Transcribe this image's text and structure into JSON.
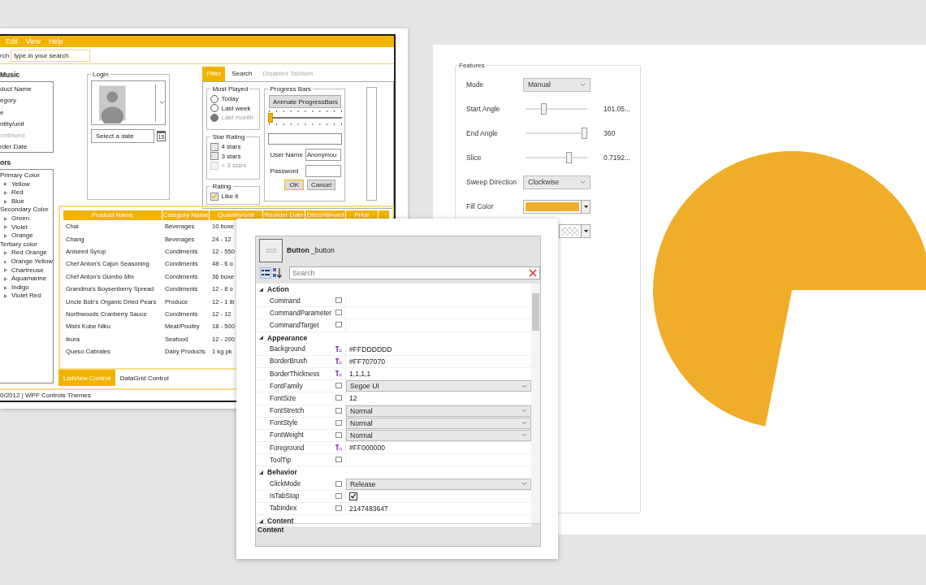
{
  "left_window": {
    "menu": [
      "Edit",
      "View",
      "Help"
    ],
    "search": {
      "label": "rch",
      "placeholder": "type in your search"
    },
    "list_header": "Music",
    "list_items": [
      {
        "label": "duct Name",
        "disabled": false
      },
      {
        "label": "egory",
        "disabled": false
      },
      {
        "label": "e",
        "disabled": false
      },
      {
        "label": "ntity/unit",
        "disabled": false
      },
      {
        "label": "ontinued",
        "disabled": true
      },
      {
        "label": "rder Date",
        "disabled": false
      }
    ],
    "tree_header": "ors",
    "tree": [
      {
        "label": "Primary Color",
        "children": [
          {
            "label": "Yellow",
            "expanded": false
          },
          {
            "label": "Red",
            "expanded": false
          },
          {
            "label": "Blue",
            "expanded": false
          }
        ]
      },
      {
        "label": "Secondary Color",
        "children": [
          {
            "label": "Green",
            "expanded": false
          },
          {
            "label": "Violet",
            "expanded": false
          },
          {
            "label": "Orange",
            "expanded": false
          }
        ]
      },
      {
        "label": "Tertiary color",
        "children": [
          {
            "label": "Red Orange",
            "expanded": false
          },
          {
            "label": "Orange Yellow",
            "expanded": false
          },
          {
            "label": "Chartreuse",
            "expanded": false
          },
          {
            "label": "Aquamarine",
            "expanded": false
          },
          {
            "label": "Indigo",
            "expanded": false
          },
          {
            "label": "Violet Red",
            "expanded": false
          }
        ]
      }
    ],
    "login": {
      "title": "Login",
      "date_placeholder": "Select a date",
      "calendar_day": "15"
    },
    "tabs": [
      {
        "label": "Filter",
        "selected": true,
        "disabled": false
      },
      {
        "label": "Search",
        "selected": false,
        "disabled": false
      },
      {
        "label": "Disabled TabItem",
        "selected": false,
        "disabled": true
      }
    ],
    "most_played": {
      "title": "Most Played",
      "options": [
        {
          "label": "Today",
          "selected": false,
          "disabled": false
        },
        {
          "label": "Last week",
          "selected": false,
          "disabled": false
        },
        {
          "label": "Last month",
          "selected": true,
          "disabled": true
        }
      ]
    },
    "star_rating": {
      "title": "Star Rating",
      "options": [
        {
          "label": "4 stars",
          "checked": false,
          "disabled": false
        },
        {
          "label": "3 stars",
          "checked": false,
          "disabled": false
        },
        {
          "label": "< 3 stars",
          "checked": false,
          "disabled": true
        }
      ]
    },
    "rating": {
      "title": "Rating",
      "options": [
        {
          "label": "Like it",
          "checked": true,
          "disabled": false
        }
      ]
    },
    "progress": {
      "title": "Progress Bars",
      "button": "Animate ProgressBars",
      "slider": {
        "level": 0
      },
      "bar": {
        "level": 0
      },
      "vertical_bar": {
        "level": 0
      },
      "fields": [
        {
          "label": "User Name",
          "value": "Anonymou"
        },
        {
          "label": "Password"
        }
      ],
      "buttons": [
        {
          "label": "OK",
          "default": true
        },
        {
          "label": "Cancel",
          "default": false
        }
      ]
    },
    "listview": {
      "columns": [
        "Product Name",
        "Category Name",
        "Quantity/unit",
        "Reorder Date",
        "Discontinued",
        "Price"
      ],
      "rows": [
        [
          "Chai",
          "Beverages",
          "10 boxe"
        ],
        [
          "Chang",
          "Beverages",
          "24 - 12"
        ],
        [
          "Aniseed Syrup",
          "Condiments",
          "12 - 550"
        ],
        [
          "Chef Anton's Cajun Seasoning",
          "Condiments",
          "48 - 6 o"
        ],
        [
          "Chef Anton's Gumbo Mix",
          "Condiments",
          "36 boxe"
        ],
        [
          "Grandma's Boysenberry Spread",
          "Condiments",
          "12 - 8 o"
        ],
        [
          "Uncle Bob's Organic Dried Pears",
          "Produce",
          "12 - 1 lb"
        ],
        [
          "Northwoods Cranberry Sauce",
          "Condiments",
          "12 - 12"
        ],
        [
          "Mishi Kobe Niku",
          "Meat/Poultry",
          "18 - 500"
        ],
        [
          "Ikura",
          "Seafood",
          "12 - 200"
        ],
        [
          "Queso Cabrales",
          "Dairy Products",
          "1 kg pk"
        ]
      ]
    },
    "bottom_tabs": [
      {
        "label": "ListView Control",
        "selected": true
      },
      {
        "label": "DataGrid Control",
        "selected": false
      }
    ],
    "status": "0/2012 | WPF Controls Themes"
  },
  "property_grid": {
    "type_name": "**Button** _button",
    "search_placeholder": "Search",
    "categories": [
      {
        "name": "Action",
        "expanded": true,
        "properties": [
          {
            "name": "Command",
            "local": false,
            "kind": "text"
          },
          {
            "name": "CommandParameter",
            "local": false,
            "kind": "text"
          },
          {
            "name": "CommandTarget",
            "local": false,
            "kind": "text"
          }
        ]
      },
      {
        "name": "Appearance",
        "expanded": true,
        "properties": [
          {
            "name": "Background",
            "local": true,
            "kind": "text",
            "value": "#FFDDDDDD"
          },
          {
            "name": "BorderBrush",
            "local": true,
            "kind": "text",
            "value": "#FF707070"
          },
          {
            "name": "BorderThickness",
            "local": true,
            "kind": "text",
            "value": "1,1,1,1"
          },
          {
            "name": "FontFamily",
            "local": false,
            "kind": "combo",
            "value": "Segoe UI"
          },
          {
            "name": "FontSize",
            "local": false,
            "kind": "text",
            "value": "12"
          },
          {
            "name": "FontStretch",
            "local": false,
            "kind": "combo",
            "value": "Normal"
          },
          {
            "name": "FontStyle",
            "local": false,
            "kind": "combo",
            "value": "Normal"
          },
          {
            "name": "FontWeight",
            "local": false,
            "kind": "combo",
            "value": "Normal"
          },
          {
            "name": "Foreground",
            "local": true,
            "kind": "text",
            "value": "#FF000000"
          },
          {
            "name": "ToolTip",
            "local": false,
            "kind": "text"
          }
        ]
      },
      {
        "name": "Behavior",
        "expanded": true,
        "properties": [
          {
            "name": "ClickMode",
            "local": false,
            "kind": "combo",
            "value": "Release"
          },
          {
            "name": "IsTabStop",
            "local": false,
            "kind": "check",
            "checked": true
          },
          {
            "name": "TabIndex",
            "local": false,
            "kind": "text",
            "value": "2147483647"
          }
        ]
      },
      {
        "name": "Content",
        "expanded": true
      }
    ],
    "description": "Content"
  },
  "features": {
    "title": "Features",
    "rows": [
      {
        "kind": "combo",
        "label": "Mode",
        "value": "Manual"
      },
      {
        "kind": "slider",
        "label": "Start Angle",
        "level": 0.2807,
        "reading": "101.05..."
      },
      {
        "kind": "slider",
        "label": "End Angle",
        "level": 1,
        "reading": "360"
      },
      {
        "kind": "slider",
        "label": "Slice",
        "level": 0.72,
        "reading": "0.7192..."
      },
      {
        "kind": "combo",
        "label": "Sweep Direction",
        "value": "Clockwise"
      },
      {
        "kind": "color",
        "label": "Fill Color",
        "color": "#f0ad29"
      },
      {
        "kind": "pattern"
      }
    ]
  }
}
